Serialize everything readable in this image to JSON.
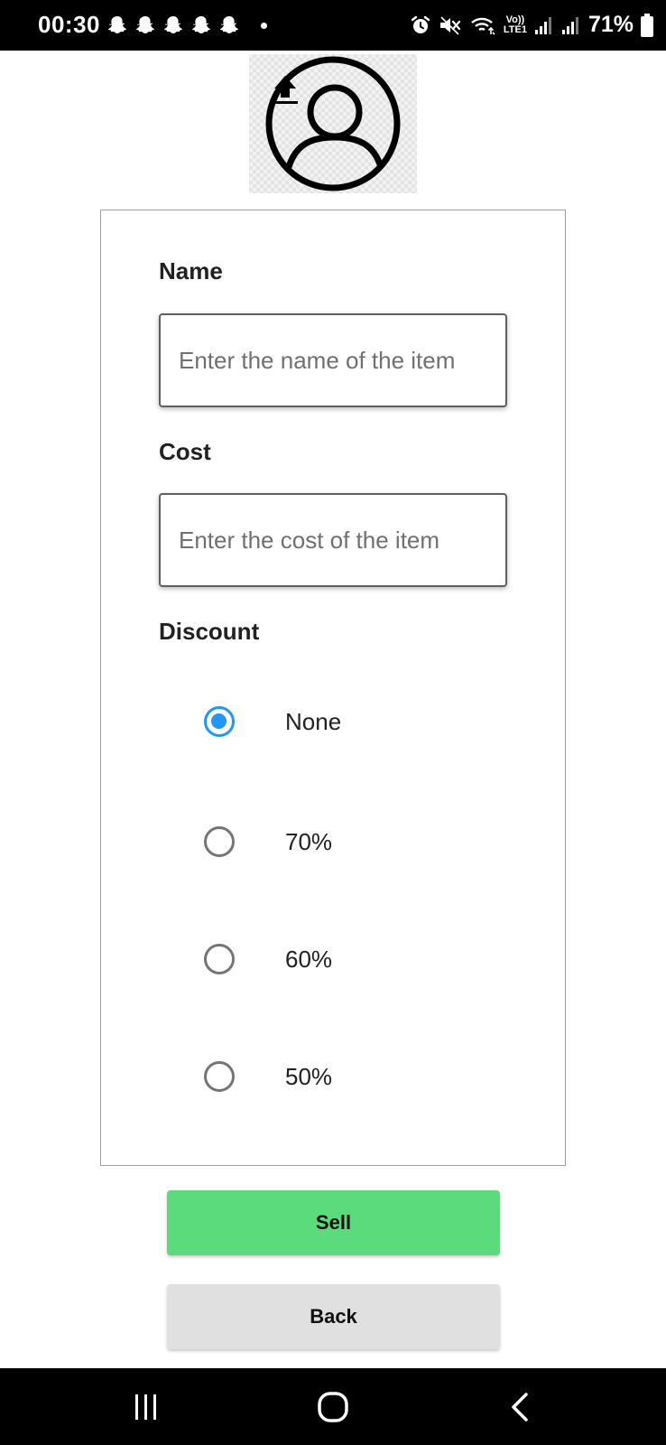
{
  "status_bar": {
    "time": "00:30",
    "volte_top": "Vo))",
    "volte_bottom": "LTE1",
    "battery": "71%",
    "notification_icons": [
      "snapchat-icon",
      "snapchat-icon",
      "snapchat-icon",
      "snapchat-icon",
      "snapchat-icon"
    ],
    "system_icons": [
      "alarm-icon",
      "mute-icon",
      "wifi-icon",
      "signal-icon",
      "signal-icon",
      "battery-icon"
    ]
  },
  "avatar": {
    "icon": "user-avatar-icon",
    "upload_icon": "upload-icon"
  },
  "form": {
    "name_label": "Name",
    "name_placeholder": "Enter the name of the item",
    "name_value": "",
    "cost_label": "Cost",
    "cost_placeholder": "Enter the cost of the item",
    "cost_value": "",
    "discount_label": "Discount",
    "discount_options": [
      {
        "label": "None",
        "selected": true
      },
      {
        "label": "70%",
        "selected": false
      },
      {
        "label": "60%",
        "selected": false
      },
      {
        "label": "50%",
        "selected": false
      }
    ]
  },
  "actions": {
    "sell_label": "Sell",
    "back_label": "Back"
  },
  "colors": {
    "accent": "#2196f3",
    "sell_button": "#5cdb7c",
    "back_button": "#e0e0e0",
    "bars": "#000000"
  },
  "nav_bar": {
    "icons": [
      "recents-icon",
      "home-icon",
      "back-icon"
    ]
  }
}
